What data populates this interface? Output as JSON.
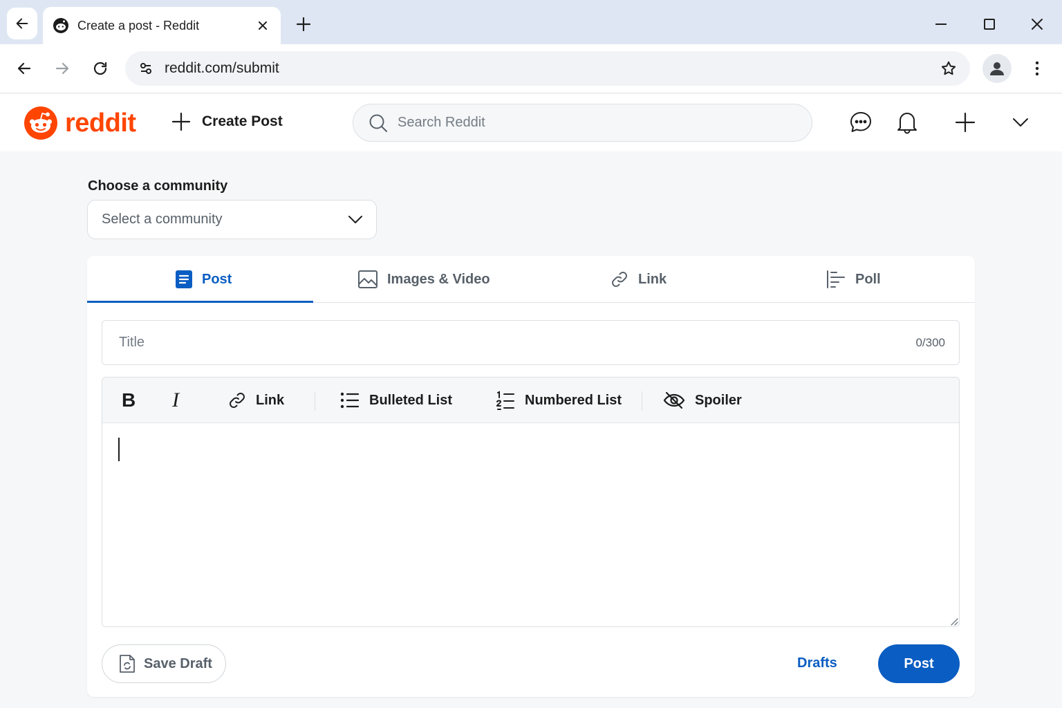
{
  "browser": {
    "tab_title": "Create a post - Reddit",
    "url": "reddit.com/submit"
  },
  "header": {
    "logo_text": "reddit",
    "create_post_label": "Create Post",
    "search_placeholder": "Search Reddit"
  },
  "community": {
    "label": "Choose a community",
    "placeholder": "Select a community"
  },
  "post_tabs": [
    {
      "label": "Post",
      "icon": "post-icon",
      "active": true
    },
    {
      "label": "Images & Video",
      "icon": "image-icon",
      "active": false
    },
    {
      "label": "Link",
      "icon": "link-icon",
      "active": false
    },
    {
      "label": "Poll",
      "icon": "poll-icon",
      "active": false
    }
  ],
  "title_field": {
    "placeholder": "Title",
    "counter": "0/300"
  },
  "editor_toolbar": {
    "bold": "B",
    "italic": "I",
    "link": "Link",
    "bulleted_list": "Bulleted List",
    "numbered_list": "Numbered List",
    "spoiler": "Spoiler"
  },
  "footer": {
    "save_draft": "Save Draft",
    "drafts": "Drafts",
    "post": "Post"
  },
  "colors": {
    "brand": "#ff4500",
    "accent": "#0a5dc2",
    "text": "#1c1c1c",
    "muted": "#576069"
  }
}
